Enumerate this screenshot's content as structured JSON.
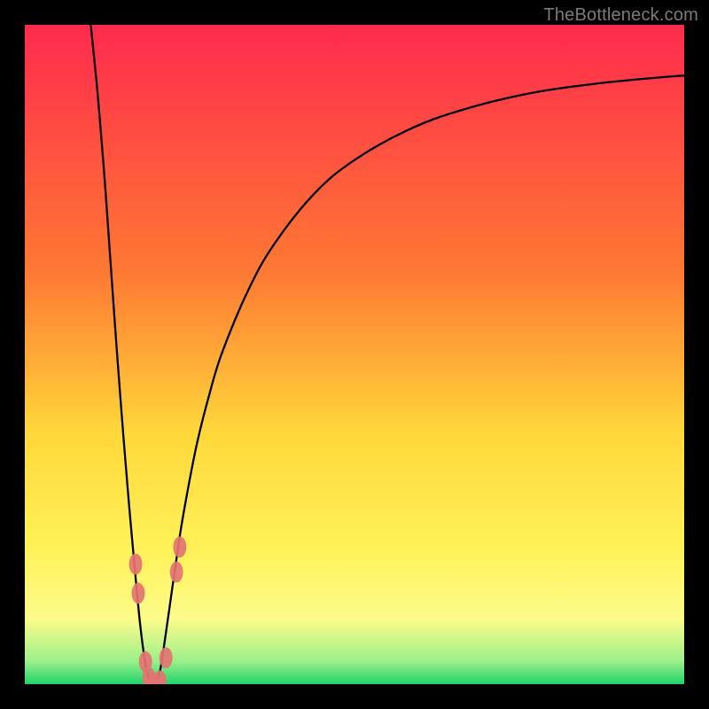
{
  "watermark": "TheBottleneck.com",
  "chart_data": {
    "type": "line",
    "title": "",
    "xlabel": "",
    "ylabel": "",
    "xlim": [
      0,
      100
    ],
    "ylim": [
      0,
      100
    ],
    "background_gradient": {
      "top": "#ff2a4d",
      "stops": [
        {
          "offset": 0.0,
          "color": "#ff2a4d"
        },
        {
          "offset": 0.38,
          "color": "#ff7a33"
        },
        {
          "offset": 0.62,
          "color": "#ffd83a"
        },
        {
          "offset": 0.8,
          "color": "#fff25a"
        },
        {
          "offset": 0.9,
          "color": "#fdfc8a"
        },
        {
          "offset": 0.965,
          "color": "#9df08a"
        },
        {
          "offset": 1.0,
          "color": "#1fd46a"
        }
      ]
    },
    "series": [
      {
        "name": "curve-left",
        "points": [
          {
            "x": 10.0,
            "y": 100.0
          },
          {
            "x": 11.0,
            "y": 90.0
          },
          {
            "x": 12.0,
            "y": 78.0
          },
          {
            "x": 13.0,
            "y": 64.0
          },
          {
            "x": 14.0,
            "y": 50.0
          },
          {
            "x": 15.0,
            "y": 37.0
          },
          {
            "x": 16.0,
            "y": 25.0
          },
          {
            "x": 17.0,
            "y": 14.0
          },
          {
            "x": 17.5,
            "y": 9.0
          },
          {
            "x": 18.0,
            "y": 5.0
          },
          {
            "x": 18.5,
            "y": 2.0
          },
          {
            "x": 19.0,
            "y": 0.5
          },
          {
            "x": 19.6,
            "y": 0.0
          }
        ]
      },
      {
        "name": "curve-right",
        "points": [
          {
            "x": 19.6,
            "y": 0.0
          },
          {
            "x": 20.0,
            "y": 0.5
          },
          {
            "x": 20.5,
            "y": 2.0
          },
          {
            "x": 21.0,
            "y": 5.0
          },
          {
            "x": 22.0,
            "y": 12.0
          },
          {
            "x": 23.0,
            "y": 19.0
          },
          {
            "x": 24.0,
            "y": 25.5
          },
          {
            "x": 26.0,
            "y": 36.0
          },
          {
            "x": 28.0,
            "y": 44.0
          },
          {
            "x": 30.0,
            "y": 50.5
          },
          {
            "x": 34.0,
            "y": 60.0
          },
          {
            "x": 38.0,
            "y": 67.0
          },
          {
            "x": 44.0,
            "y": 74.5
          },
          {
            "x": 50.0,
            "y": 79.5
          },
          {
            "x": 58.0,
            "y": 84.0
          },
          {
            "x": 66.0,
            "y": 87.0
          },
          {
            "x": 76.0,
            "y": 89.5
          },
          {
            "x": 86.0,
            "y": 91.0
          },
          {
            "x": 96.0,
            "y": 92.0
          },
          {
            "x": 100.0,
            "y": 92.3
          }
        ]
      }
    ],
    "scatter": {
      "name": "markers",
      "color": "#e57373",
      "rx": 1.0,
      "ry": 1.6,
      "points": [
        {
          "x": 16.8,
          "y": 18.2
        },
        {
          "x": 17.2,
          "y": 13.8
        },
        {
          "x": 18.3,
          "y": 3.4
        },
        {
          "x": 18.8,
          "y": 1.0
        },
        {
          "x": 19.6,
          "y": 0.0
        },
        {
          "x": 20.5,
          "y": 0.5
        },
        {
          "x": 21.4,
          "y": 4.0
        },
        {
          "x": 23.0,
          "y": 17.0
        },
        {
          "x": 23.5,
          "y": 20.8
        }
      ]
    }
  }
}
